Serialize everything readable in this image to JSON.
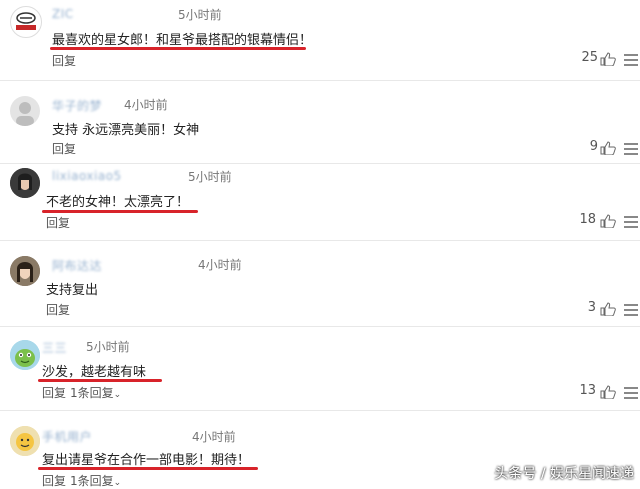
{
  "reply_label": "回复",
  "comments": [
    {
      "username": "ZIC",
      "time": "5小时前",
      "text": "最喜欢的星女郎！和星爷最搭配的银幕情侣！",
      "likes": "25"
    },
    {
      "username": "华子的梦",
      "time": "4小时前",
      "text": "支持 永远漂亮美丽！女神",
      "likes": "9"
    },
    {
      "username": "lixiaoxiao5",
      "time": "5小时前",
      "text": "不老的女神！太漂亮了！",
      "likes": "18"
    },
    {
      "username": "阿布达达",
      "time": "4小时前",
      "text": "支持复出",
      "likes": "3"
    },
    {
      "username": "三三",
      "time": "5小时前",
      "text": "沙发，越老越有味",
      "likes": "13",
      "sub_replies": "1条回复"
    },
    {
      "username": "手机用户",
      "time": "4小时前",
      "text": "复出请星爷在合作一部电影！期待！",
      "likes": "",
      "sub_replies": "1条回复"
    }
  ],
  "watermark": "头条号 / 娱乐星闻速递",
  "accent_color": "#d8232a"
}
